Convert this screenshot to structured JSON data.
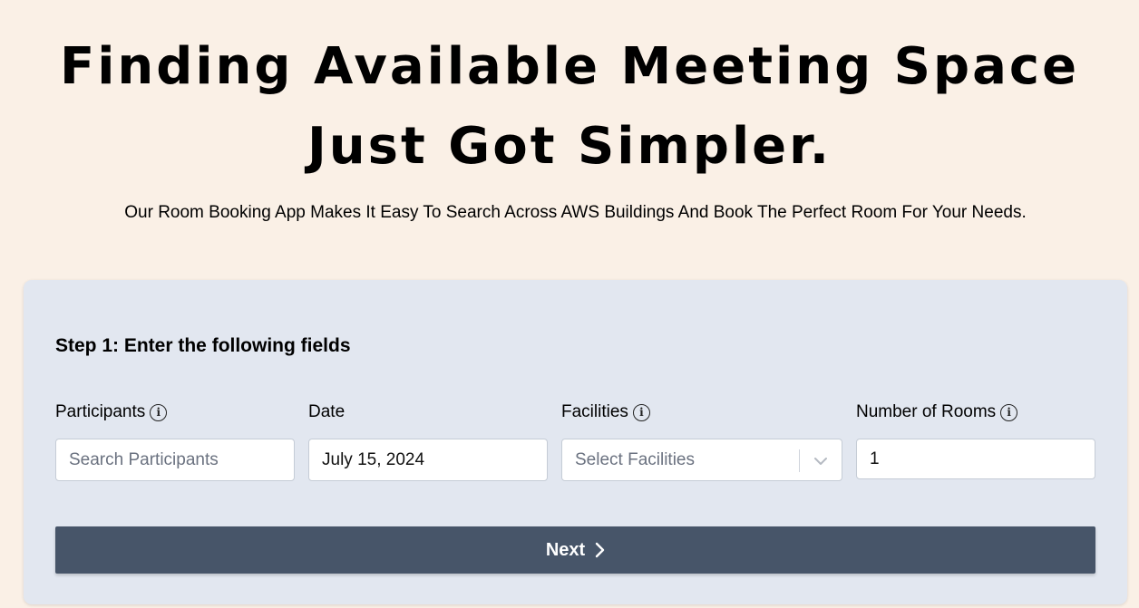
{
  "hero": {
    "title_line1": "Finding Available Meeting Space",
    "title_line2": "Just Got Simpler.",
    "subtitle": "Our Room Booking App Makes It Easy To Search Across AWS Buildings And Book The Perfect Room For Your Needs."
  },
  "form": {
    "step_heading": "Step 1: Enter the following fields",
    "participants": {
      "label": "Participants",
      "placeholder": "Search Participants",
      "has_info_icon": true
    },
    "date": {
      "label": "Date",
      "value": "July 15, 2024"
    },
    "facilities": {
      "label": "Facilities",
      "placeholder": "Select Facilities",
      "has_info_icon": true
    },
    "rooms": {
      "label": "Number of Rooms",
      "value": "1",
      "has_info_icon": true
    },
    "next_button": {
      "label": "Next",
      "icon": "chevron-right-icon"
    }
  },
  "colors": {
    "page_background": "#faf0e6",
    "card_background": "#e2e7f0",
    "button_background": "#475569",
    "button_text": "#ffffff"
  }
}
